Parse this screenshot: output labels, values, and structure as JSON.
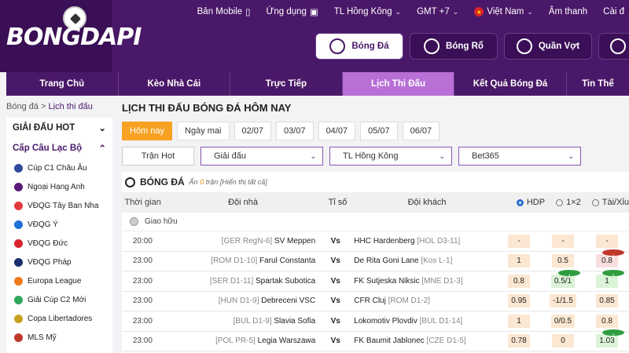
{
  "brand": {
    "logo_text": "BONGDAPI"
  },
  "util": {
    "mobile": "Bản Mobile",
    "app": "Ứng dụng",
    "tz": "TL Hồng Kông",
    "gmt": "GMT +7",
    "lang": "Việt Nam",
    "sound": "Âm thanh",
    "settings": "Cài đ"
  },
  "sports": [
    {
      "label": "Bóng Đá",
      "icon": "soccer-ball-icon"
    },
    {
      "label": "Bóng Rổ",
      "icon": "basketball-icon"
    },
    {
      "label": "Quần Vợt",
      "icon": "tennis-ball-icon"
    },
    {
      "label": "",
      "icon": "baseball-icon"
    }
  ],
  "nav": [
    "Trang Chủ",
    "Kèo Nhà Cái",
    "Trực Tiếp",
    "Lịch Thi Đấu",
    "Kết Quả Bóng Đá",
    "Tin Thể"
  ],
  "breadcrumb": {
    "root": "Bóng đá",
    "sep": ">",
    "current": "Lịch thi đấu"
  },
  "sidebar": {
    "hot_label": "GIẢI ĐẤU HOT",
    "club_label": "Cấp Câu Lạc Bộ",
    "items": [
      {
        "label": "Cúp C1 Châu Âu",
        "color": "#2f4a9a"
      },
      {
        "label": "Ngoại Hạng Anh",
        "color": "#5a1a7a"
      },
      {
        "label": "VĐQG Tây Ban Nha",
        "color": "#e23a3a"
      },
      {
        "label": "VĐQG Ý",
        "color": "#1d6fd6"
      },
      {
        "label": "VĐQG Đức",
        "color": "#d8232a"
      },
      {
        "label": "VĐQG Pháp",
        "color": "#1b2f6a"
      },
      {
        "label": "Europa League",
        "color": "#f07a1a"
      },
      {
        "label": "Giải Cúp C2 Mới",
        "color": "#2fa65a"
      },
      {
        "label": "Copa Libertadores",
        "color": "#c8a020"
      },
      {
        "label": "MLS Mỹ",
        "color": "#c0392b"
      }
    ]
  },
  "main": {
    "title": "LỊCH THI ĐẤU BÓNG ĐÁ HÔM NAY",
    "days": [
      "Hôm nay",
      "Ngày mai",
      "02/07",
      "03/07",
      "04/07",
      "05/07",
      "06/07"
    ],
    "filters": {
      "hot": "Trận Hot",
      "league": "Giải đấu",
      "tz": "TL Hồng Kông",
      "book": "Bet365"
    }
  },
  "table": {
    "sport": "BÓNG ĐÁ",
    "hidden_prefix": "Ẩn",
    "hidden_count": "0",
    "hidden_suffix": "trận [Hiển thị tất cả]",
    "headers": {
      "time": "Thời gian",
      "home": "Đội nhà",
      "score": "Tỉ số",
      "away": "Đội khách",
      "hdp": "HDP",
      "x12": "1×2",
      "ou": "Tài/Xỉu"
    },
    "league": "Giao hữu",
    "rows": [
      {
        "time": "20:00",
        "home_rank": "[GER RegN-6]",
        "home": "SV Meppen",
        "vs": "Vs",
        "away": "HHC Hardenberg",
        "away_rank": "[HOL D3-11]",
        "o1": "-",
        "o2": "-",
        "o3": "-"
      },
      {
        "time": "23:00",
        "home_rank": "[ROM D1-10]",
        "home": "Farul Constanta",
        "vs": "Vs",
        "away": "De Rita Goni Lane",
        "away_rank": "[Kos L-1]",
        "o1": "1",
        "o2": "0.5",
        "o3": "0.8"
      },
      {
        "time": "23:00",
        "home_rank": "[SER D1-11]",
        "home": "Spartak Subotica",
        "vs": "Vs",
        "away": "FK Sutjeska Niksic",
        "away_rank": "[MNE D1-3]",
        "o1": "0.8",
        "o2": "0.5/1",
        "o3": "1"
      },
      {
        "time": "23:00",
        "home_rank": "[HUN D1-9]",
        "home": "Debreceni VSC",
        "vs": "Vs",
        "away": "CFR Cluj",
        "away_rank": "[ROM D1-2]",
        "o1": "0.95",
        "o2": "-1/1.5",
        "o3": "0.85"
      },
      {
        "time": "23:00",
        "home_rank": "[BUL D1-9]",
        "home": "Slavia Sofia",
        "vs": "Vs",
        "away": "Lokomotiv Plovdiv",
        "away_rank": "[BUL D1-14]",
        "o1": "1",
        "o2": "0/0.5",
        "o3": "0.8"
      },
      {
        "time": "23:00",
        "home_rank": "[POL PR-5]",
        "home": "Legia Warszawa",
        "vs": "Vs",
        "away": "FK Baumit Jablonec",
        "away_rank": "[CZE D1-5]",
        "o1": "0.78",
        "o2": "0",
        "o3": "1.03"
      }
    ]
  }
}
